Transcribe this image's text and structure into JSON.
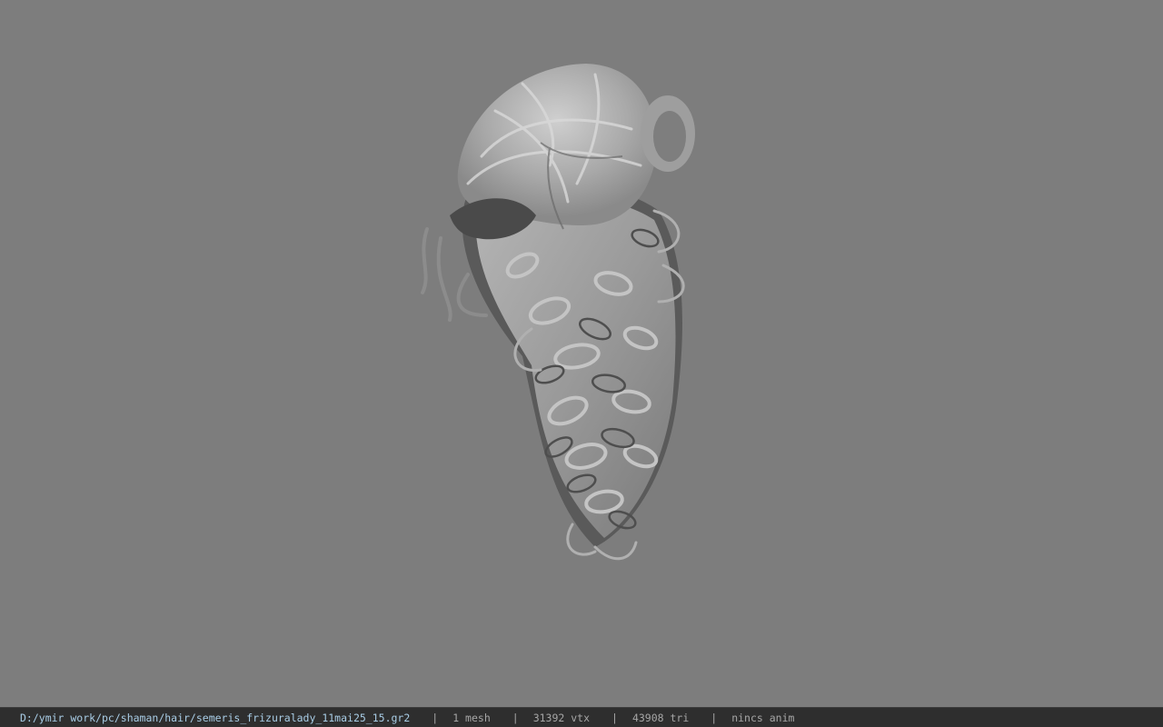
{
  "viewport": {
    "background_color": "#7d7d7d",
    "model_icon": "hair-mesh-render"
  },
  "status_bar": {
    "background_color": "#2e2e2e",
    "path_color": "#a9cde6",
    "file_path": "D:/ymir work/pc/shaman/hair/semeris_frizuralady_11mai25_15.gr2",
    "separator": "|",
    "mesh_count": "1 mesh",
    "vertex_count": "31392 vtx",
    "triangle_count": "43908 tri",
    "anim_status": "nincs anim"
  }
}
